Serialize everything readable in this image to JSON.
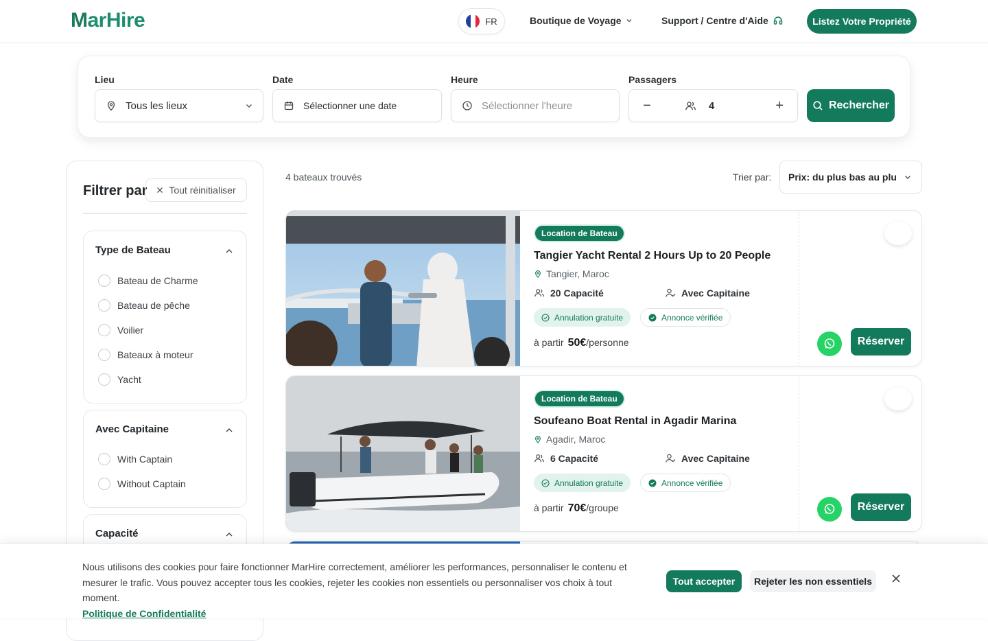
{
  "brand": {
    "name_prefix": "M",
    "name_rest": "arHire",
    "accent": "#137a5c"
  },
  "header": {
    "lang": "FR",
    "shop_label": "Boutique de Voyage",
    "support_label": "Support / Centre d'Aide",
    "list_button": "Listez Votre Propriété"
  },
  "search": {
    "lieu_label": "Lieu",
    "lieu_value": "Tous les lieux",
    "date_label": "Date",
    "date_value": "Sélectionner une date",
    "heure_label": "Heure",
    "heure_placeholder": "Sélectionner l'heure",
    "passagers_label": "Passagers",
    "passagers_value": "4",
    "search_button": "Rechercher"
  },
  "filters": {
    "title": "Filtrer par",
    "reset_label": "Tout réinitialiser",
    "type": {
      "title": "Type de Bateau",
      "options": [
        "Bateau de Charme",
        "Bateau de pêche",
        "Voilier",
        "Bateaux à moteur",
        "Yacht"
      ]
    },
    "captain": {
      "title": "Avec Capitaine",
      "options": [
        "With Captain",
        "Without Captain"
      ]
    },
    "capacity": {
      "title": "Capacité"
    }
  },
  "results": {
    "count_text": "4 bateaux trouvés",
    "sort_label": "Trier par:",
    "sort_value": "Prix: du plus bas au plus élevé",
    "cards": [
      {
        "badge": "Location de Bateau",
        "title": "Tangier Yacht Rental 2 Hours Up to 20 People",
        "location": "Tangier, Maroc",
        "capacity": "20 Capacité",
        "captain": "Avec Capitaine",
        "tag_free": "Annulation gratuite",
        "tag_verified": "Annonce vérifiée",
        "price_prefix": "à partir",
        "price": "50€",
        "price_unit": "/personne",
        "reserve": "Réserver"
      },
      {
        "badge": "Location de Bateau",
        "title": "Soufeano Boat Rental in Agadir Marina",
        "location": "Agadir, Maroc",
        "capacity": "6 Capacité",
        "captain": "Avec Capitaine",
        "tag_free": "Annulation gratuite",
        "tag_verified": "Annonce vérifiée",
        "price_prefix": "à partir",
        "price": "70€",
        "price_unit": "/groupe",
        "reserve": "Réserver"
      }
    ]
  },
  "cookie": {
    "text": "Nous utilisons des cookies pour faire fonctionner MarHire correctement, améliorer les performances, personnaliser le contenu et mesurer le trafic. Vous pouvez accepter tous les cookies, rejeter les cookies non essentiels ou personnaliser vos choix à tout moment.",
    "link": "Politique de Confidentialité",
    "accept": "Tout accepter",
    "reject": "Rejeter les non essentiels"
  }
}
